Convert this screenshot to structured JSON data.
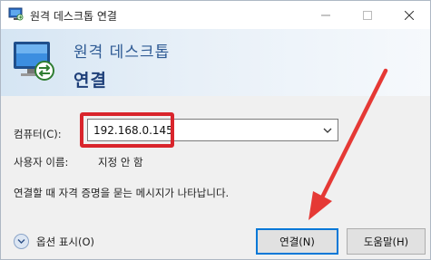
{
  "window": {
    "title": "원격 데스크톱 연결",
    "icons": {
      "app": "remote-desktop-icon",
      "minimize": "minimize-icon",
      "maximize": "maximize-icon",
      "close": "close-icon"
    }
  },
  "banner": {
    "subtitle": "원격 데스크톱",
    "title": "연결",
    "icon": "monitor-connection-icon"
  },
  "form": {
    "computer_label": "컴퓨터(C):",
    "computer_value": "192.168.0.145",
    "user_label": "사용자 이름:",
    "user_value": "지정 안 함",
    "info_text": "연결할 때 자격 증명을 묻는 메시지가 나타납니다."
  },
  "footer": {
    "options_label": "옵션 표시(O)",
    "connect_label": "연결(N)",
    "help_label": "도움말(H)"
  },
  "annotation": {
    "highlight_color": "#d9252c",
    "arrow_color": "#e53935"
  }
}
